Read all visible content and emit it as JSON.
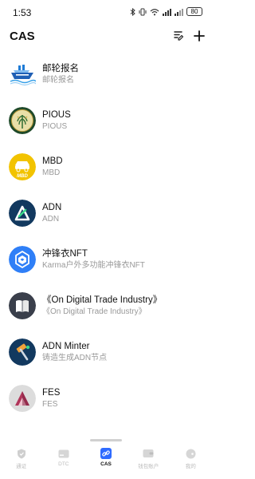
{
  "status": {
    "time": "1:53",
    "battery": "80"
  },
  "header": {
    "title": "CAS"
  },
  "items": [
    {
      "name": "邮轮报名",
      "sub": "邮轮报名"
    },
    {
      "name": "PIOUS",
      "sub": "PIOUS"
    },
    {
      "name": "MBD",
      "sub": "MBD"
    },
    {
      "name": "ADN",
      "sub": "ADN"
    },
    {
      "name": "冲锋衣NFT",
      "sub": "Karma户外多功能冲锋衣NFT"
    },
    {
      "name": "《On Digital Trade Industry》",
      "sub": "《On Digital Trade Industry》"
    },
    {
      "name": "ADN Minter",
      "sub": "铸造生成ADN节点"
    },
    {
      "name": "FES",
      "sub": "FES"
    }
  ],
  "tabs": [
    {
      "label": "通证",
      "icon": "shield-icon"
    },
    {
      "label": "DTC",
      "icon": "card-icon"
    },
    {
      "label": "CAS",
      "icon": "link-icon",
      "active": true
    },
    {
      "label": "钱包账户",
      "icon": "wallet-icon"
    },
    {
      "label": "我的",
      "icon": "profile-icon"
    }
  ],
  "colors": {
    "accent": "#2f6bff",
    "inactive": "#c8c8c8"
  }
}
